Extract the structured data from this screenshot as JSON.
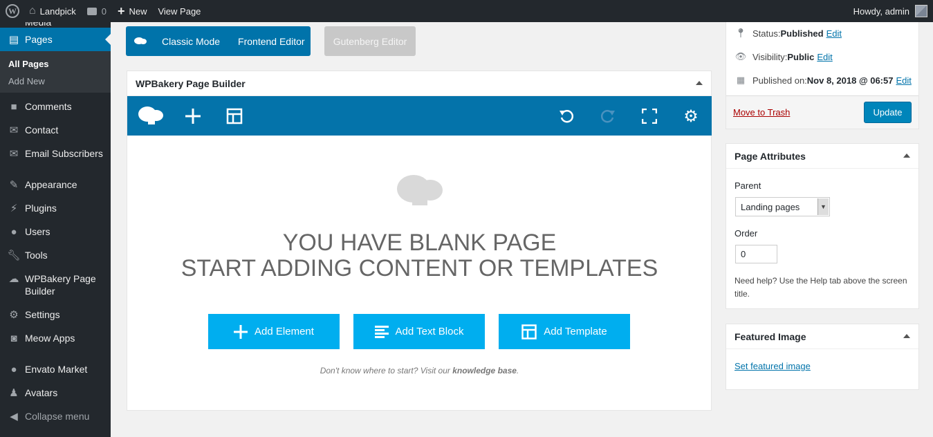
{
  "adminbar": {
    "site_name": "Landpick",
    "comments_count": "0",
    "new_label": "New",
    "view_label": "View Page",
    "howdy": "Howdy, admin"
  },
  "sidebar": {
    "top_partial": "Media",
    "items": [
      {
        "label": "Pages",
        "icon": "pages-icon"
      },
      {
        "label": "Comments",
        "icon": "comments-icon"
      },
      {
        "label": "Contact",
        "icon": "mail-icon"
      },
      {
        "label": "Email Subscribers",
        "icon": "mail-icon"
      },
      {
        "label": "Appearance",
        "icon": "brush-icon"
      },
      {
        "label": "Plugins",
        "icon": "plugin-icon"
      },
      {
        "label": "Users",
        "icon": "user-icon"
      },
      {
        "label": "Tools",
        "icon": "wrench-icon"
      },
      {
        "label": "WPBakery Page",
        "label2": "Builder",
        "icon": "wpbakery-icon"
      },
      {
        "label": "Settings",
        "icon": "settings-icon"
      },
      {
        "label": "Meow Apps",
        "icon": "camera-icon"
      },
      {
        "label": "Envato Market",
        "icon": "envato-icon"
      },
      {
        "label": "Avatars",
        "icon": "avatar-icon"
      },
      {
        "label": "Collapse menu",
        "icon": "collapse-icon"
      }
    ],
    "submenu": [
      "All Pages",
      "Add New"
    ]
  },
  "editor_switch": {
    "classic": "Classic Mode",
    "frontend": "Frontend Editor",
    "gutenberg": "Gutenberg Editor"
  },
  "builder": {
    "title": "WPBakery Page Builder",
    "blank_line1": "YOU HAVE BLANK PAGE",
    "blank_line2": "START ADDING CONTENT OR TEMPLATES",
    "add_element": "Add Element",
    "add_text_block": "Add Text Block",
    "add_template": "Add Template",
    "help_prefix": "Don't know where to start? Visit our ",
    "help_link": "knowledge base",
    "help_suffix": "."
  },
  "publish": {
    "status_label": "Status: ",
    "status_value": "Published",
    "visibility_label": "Visibility: ",
    "visibility_value": "Public",
    "published_label": "Published on: ",
    "published_value": "Nov 8, 2018 @ 06:57",
    "edit": "Edit",
    "trash": "Move to Trash",
    "update": "Update"
  },
  "page_attributes": {
    "title": "Page Attributes",
    "parent_label": "Parent",
    "parent_value": "Landing pages",
    "order_label": "Order",
    "order_value": "0",
    "help": "Need help? Use the Help tab above the screen title."
  },
  "featured_image": {
    "title": "Featured Image",
    "link": "Set featured image"
  },
  "colors": {
    "admin_dark": "#23282d",
    "wp_blue": "#0073aa",
    "vc_bar": "#0473aa",
    "cta_blue": "#00aeef"
  }
}
